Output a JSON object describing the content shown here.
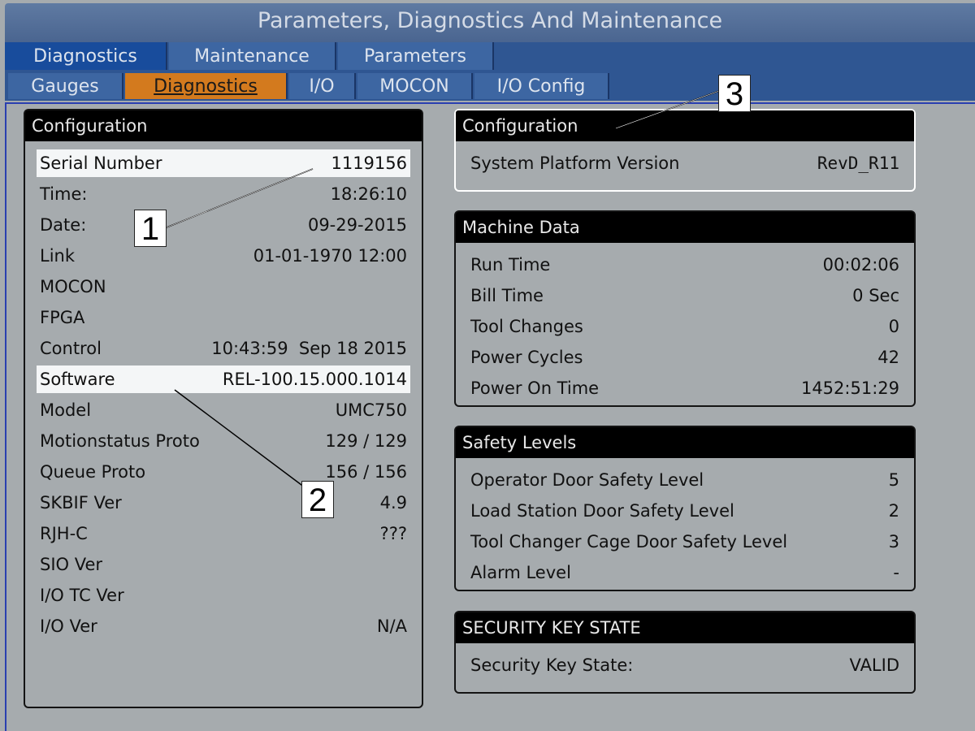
{
  "window": {
    "title": "Parameters, Diagnostics And Maintenance"
  },
  "main_tabs": [
    {
      "label": "Diagnostics",
      "active": true
    },
    {
      "label": "Maintenance",
      "active": false
    },
    {
      "label": "Parameters",
      "active": false
    }
  ],
  "sub_tabs": [
    {
      "label": "Gauges",
      "active": false
    },
    {
      "label": "Diagnostics",
      "active": true
    },
    {
      "label": "I/O",
      "active": false
    },
    {
      "label": "MOCON",
      "active": false
    },
    {
      "label": "I/O Config",
      "active": false
    }
  ],
  "config_left": {
    "title": "Configuration",
    "rows": [
      {
        "label": "Serial Number",
        "value": "1119156"
      },
      {
        "label": "Time:",
        "value": "18:26:10"
      },
      {
        "label": "Date:",
        "value": "09-29-2015"
      },
      {
        "label": "Link",
        "value": "01-01-1970 12:00"
      },
      {
        "label": "MOCON",
        "value": ""
      },
      {
        "label": "FPGA",
        "value": ""
      },
      {
        "label": "Control",
        "value": "10:43:59  Sep 18 2015"
      },
      {
        "label": "Software",
        "value": "REL-100.15.000.1014"
      },
      {
        "label": "Model",
        "value": "UMC750"
      },
      {
        "label": "Motionstatus Proto",
        "value": "129 / 129"
      },
      {
        "label": "Queue Proto",
        "value": "156 / 156"
      },
      {
        "label": "SKBIF Ver",
        "value": "4.9"
      },
      {
        "label": "RJH-C",
        "value": "???"
      },
      {
        "label": "SIO Ver",
        "value": ""
      },
      {
        "label": "I/O TC Ver",
        "value": ""
      },
      {
        "label": "I/O Ver",
        "value": "N/A"
      }
    ]
  },
  "config_right": {
    "title": "Configuration",
    "rows": [
      {
        "label": "System Platform Version",
        "value": "RevD_R11"
      }
    ]
  },
  "machine_data": {
    "title": "Machine Data",
    "rows": [
      {
        "label": "Run Time",
        "value": "00:02:06"
      },
      {
        "label": "Bill Time",
        "value": "0 Sec"
      },
      {
        "label": "Tool Changes",
        "value": "0"
      },
      {
        "label": "Power Cycles",
        "value": "42"
      },
      {
        "label": "Power On Time",
        "value": "1452:51:29"
      }
    ]
  },
  "safety_levels": {
    "title": "Safety Levels",
    "rows": [
      {
        "label": "Operator Door Safety Level",
        "value": "5"
      },
      {
        "label": "Load Station Door Safety Level",
        "value": "2"
      },
      {
        "label": "Tool Changer Cage Door Safety Level",
        "value": "3"
      },
      {
        "label": "Alarm Level",
        "value": "-"
      }
    ]
  },
  "security_key": {
    "title": "SECURITY KEY STATE",
    "rows": [
      {
        "label": "Security Key State:",
        "value": "VALID"
      }
    ]
  },
  "callouts": {
    "one": "1",
    "two": "2",
    "three": "3"
  },
  "colors": {
    "active_tab": "#d37a1e",
    "tab_bar": "#2f5692",
    "panel_header": "#000000",
    "highlight_row": "#f4f6f7"
  }
}
